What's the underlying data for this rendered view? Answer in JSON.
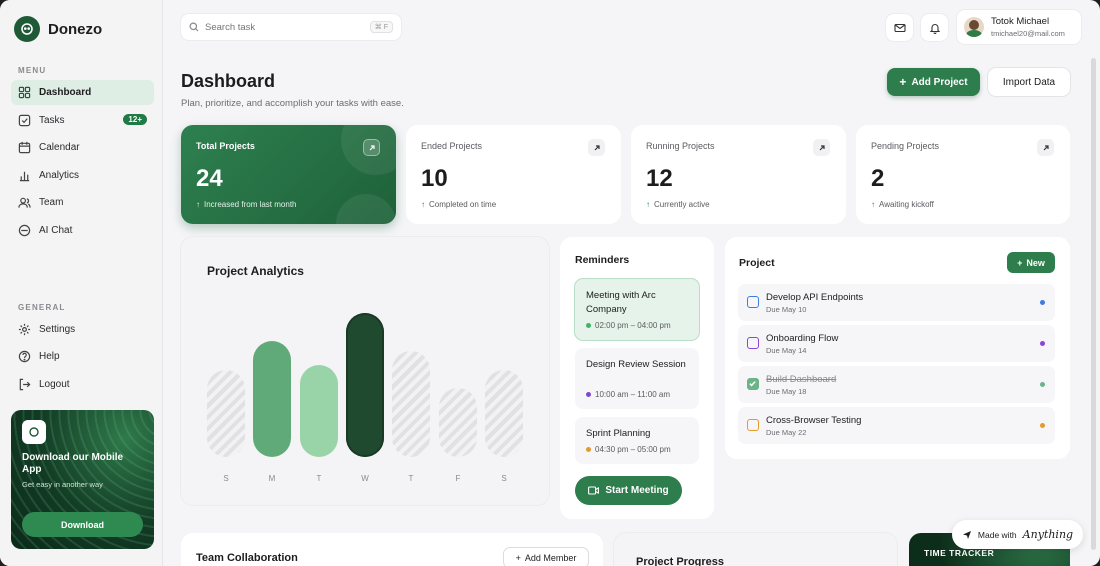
{
  "brand": {
    "name": "Donezo"
  },
  "sidebar": {
    "menu_label": "MENU",
    "items": [
      {
        "label": "Dashboard",
        "icon": "grid-icon",
        "active": true
      },
      {
        "label": "Tasks",
        "icon": "checklist-icon",
        "badge": "12+"
      },
      {
        "label": "Calendar",
        "icon": "calendar-icon"
      },
      {
        "label": "Analytics",
        "icon": "bar-chart-icon"
      },
      {
        "label": "Team",
        "icon": "users-icon"
      },
      {
        "label": "AI Chat",
        "icon": "circle-icon"
      }
    ],
    "general_label": "GENERAL",
    "general_items": [
      {
        "label": "Settings",
        "icon": "gear-icon"
      },
      {
        "label": "Help",
        "icon": "help-icon"
      },
      {
        "label": "Logout",
        "icon": "logout-icon"
      }
    ],
    "promo": {
      "title": "Download our Mobile App",
      "subtitle": "Get easy in another way",
      "button": "Download"
    }
  },
  "topbar": {
    "search_placeholder": "Search task",
    "shortcut": "⌘ F",
    "user": {
      "name": "Totok Michael",
      "email": "tmichael20@mail.com"
    }
  },
  "header": {
    "title": "Dashboard",
    "subtitle": "Plan, prioritize, and accomplish your tasks with ease.",
    "add_project": "Add Project",
    "import_data": "Import Data"
  },
  "stats": [
    {
      "label": "Total Projects",
      "value": "24",
      "note": "Increased from last month"
    },
    {
      "label": "Ended Projects",
      "value": "10",
      "note": "Completed on time"
    },
    {
      "label": "Running Projects",
      "value": "12",
      "note": "Currently active"
    },
    {
      "label": "Pending Projects",
      "value": "2",
      "note": "Awaiting kickoff"
    }
  ],
  "analytics": {
    "title": "Project Analytics",
    "days": [
      "S",
      "M",
      "T",
      "W",
      "T",
      "F",
      "S"
    ],
    "levels": [
      0.52,
      0.69,
      0.55,
      0.86,
      0.63,
      0.41,
      0.52
    ],
    "styles": [
      "hatch",
      "green",
      "light",
      "dark",
      "hatch",
      "hatch",
      "hatch"
    ],
    "colors": {
      "green": "#5faa78",
      "light": "#98d4a8",
      "dark": "#1f4a30"
    }
  },
  "reminders": {
    "title": "Reminders",
    "items": [
      {
        "title": "Meeting with Arc Company",
        "time": "02:00 pm – 04:00 pm",
        "dot": "#3fb36a"
      },
      {
        "title": "Design Review Session",
        "time": "10:00 am – 11:00 am",
        "dot": "#7b4ad1"
      },
      {
        "title": "Sprint Planning",
        "time": "04:30 pm – 05:00 pm",
        "dot": "#e49a2c"
      }
    ],
    "button": "Start Meeting"
  },
  "project": {
    "title": "Project",
    "new_label": "New",
    "tasks": [
      {
        "name": "Develop API Endpoints",
        "due": "Due May 10",
        "color": "#3d7de0",
        "done": false
      },
      {
        "name": "Onboarding Flow",
        "due": "Due May 14",
        "color": "#8a46d6",
        "done": false
      },
      {
        "name": "Build Dashboard",
        "due": "Due May 18",
        "color": "#6cb388",
        "done": true
      },
      {
        "name": "Cross-Browser Testing",
        "due": "Due May 22",
        "color": "#e49a2c",
        "done": false
      }
    ]
  },
  "bottom": {
    "team_title": "Team Collaboration",
    "add_member": "Add Member",
    "progress_title": "Project Progress",
    "tracker_title": "TIME TRACKER"
  },
  "made_with": {
    "prefix": "Made with",
    "brand": "Anything"
  },
  "theme": {
    "accent": "#2e7d4c"
  }
}
